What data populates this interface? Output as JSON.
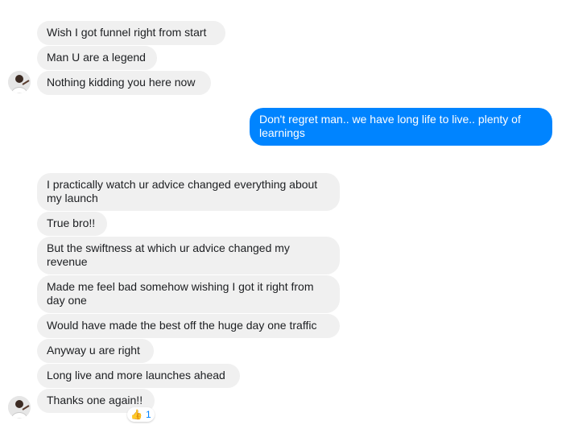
{
  "conversation": {
    "group1": [
      "Wish I got funnel right from start",
      "Man U are a legend",
      "Nothing kidding you here now"
    ],
    "outgoing": "Don't regret man.. we have long life to live.. plenty of learnings",
    "group2": [
      "I practically watch ur advice changed everything about my launch",
      "True bro!!",
      "But the swiftness at which ur advice changed my revenue",
      "Made me feel bad somehow wishing I got it right from day one",
      "Would have made the best off the huge day one traffic",
      "Anyway u are right",
      "Long live and more launches ahead",
      "Thanks one again!!"
    ],
    "reaction": {
      "icon": "thumbs-up-icon",
      "count": "1"
    }
  },
  "colors": {
    "incoming_bubble": "#f0f0f0",
    "outgoing_bubble": "#0084ff"
  }
}
